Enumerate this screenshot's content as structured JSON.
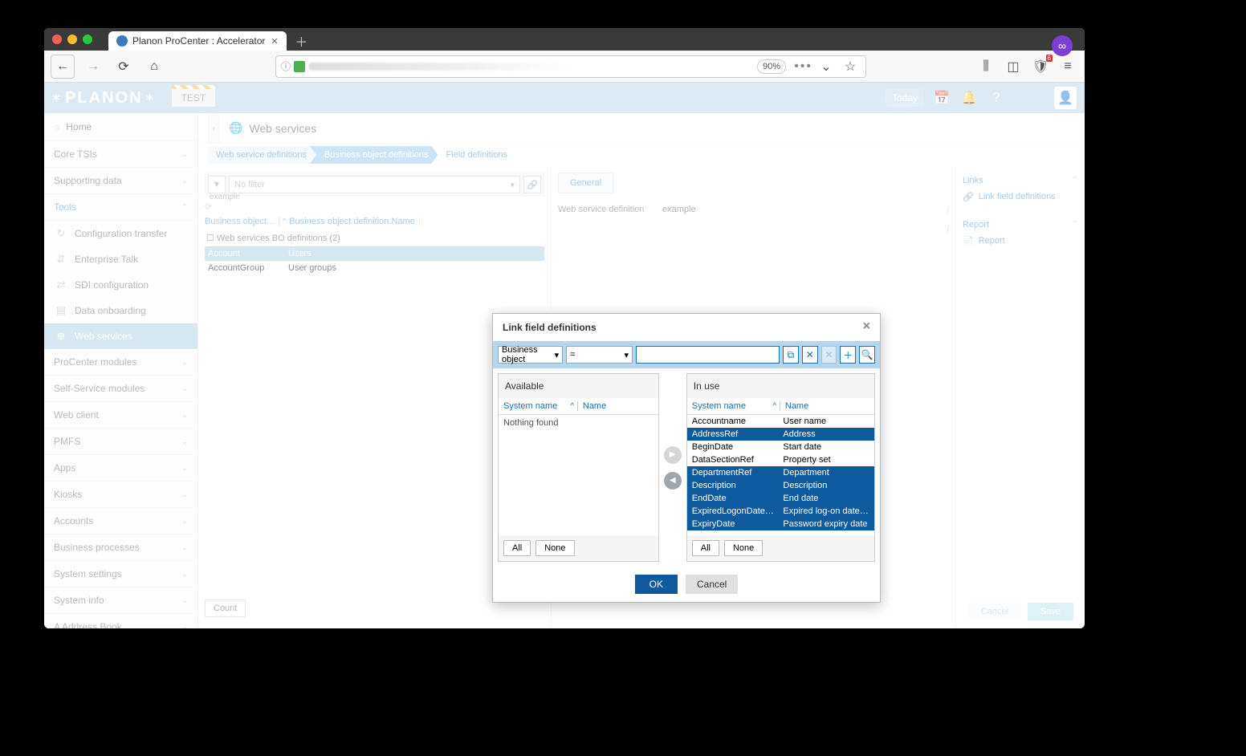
{
  "browser": {
    "tab_title": "Planon ProCenter : Accelerator",
    "zoom": "90%"
  },
  "topbar": {
    "logo": "PLANON",
    "badge": "TEST",
    "today": "Today"
  },
  "sidebar": {
    "home": "Home",
    "sections": [
      {
        "label": "Core TSIs",
        "open": false
      },
      {
        "label": "Supporting data",
        "open": false
      },
      {
        "label": "Tools",
        "open": true,
        "items": [
          {
            "label": "Configuration transfer",
            "icon": "↻"
          },
          {
            "label": "Enterprise Talk",
            "icon": "⇵"
          },
          {
            "label": "SDI configuration",
            "icon": "⇄"
          },
          {
            "label": "Data onboarding",
            "icon": "▤"
          },
          {
            "label": "Web services",
            "icon": "⊕",
            "active": true
          }
        ]
      },
      {
        "label": "ProCenter modules",
        "open": false
      },
      {
        "label": "Self-Service modules",
        "open": false
      },
      {
        "label": "Web client",
        "open": false
      },
      {
        "label": "PMFS",
        "open": false
      },
      {
        "label": "Apps",
        "open": false
      },
      {
        "label": "Kiosks",
        "open": false
      },
      {
        "label": "Accounts",
        "open": false
      },
      {
        "label": "Business processes",
        "open": false
      },
      {
        "label": "System settings",
        "open": false
      },
      {
        "label": "System info",
        "open": false
      },
      {
        "label": "A  Address Book",
        "open": false
      }
    ]
  },
  "main": {
    "title": "Web services",
    "breadcrumb": [
      "Web service definitions",
      "Business object definitions",
      "Field definitions"
    ],
    "bc_note": "example",
    "filter_placeholder": "No filter",
    "colheads": [
      "Business object…",
      "Business object definition.Name"
    ],
    "tree_label": "Web services BO definitions (2)",
    "rows": [
      {
        "c1": "Account",
        "c2": "Users",
        "sel": true
      },
      {
        "c1": "AccountGroup",
        "c2": "User groups",
        "sel": false
      }
    ],
    "count": "Count",
    "general_tab": "General",
    "kv": [
      {
        "k": "Web service definition",
        "v": "example"
      }
    ],
    "cancel": "Cancel",
    "save": "Save"
  },
  "rightpanel": {
    "links": "Links",
    "link_item": "Link field definitions",
    "report": "Report",
    "report_item": "Report"
  },
  "modal": {
    "title": "Link field definitions",
    "filter_field": "Business object",
    "filter_op": "=",
    "available": {
      "title": "Available",
      "col1": "System name",
      "col2": "Name",
      "nothing": "Nothing found",
      "all": "All",
      "none": "None"
    },
    "inuse": {
      "title": "In use",
      "col1": "System name",
      "col2": "Name",
      "rows": [
        {
          "r1": "Accountname",
          "r2": "User name",
          "sel": false
        },
        {
          "r1": "AddressRef",
          "r2": "Address",
          "sel": true
        },
        {
          "r1": "BeginDate",
          "r2": "Start date",
          "sel": false
        },
        {
          "r1": "DataSectionRef",
          "r2": "Property set",
          "sel": false
        },
        {
          "r1": "DepartmentRef",
          "r2": "Department",
          "sel": true
        },
        {
          "r1": "Description",
          "r2": "Description",
          "sel": true
        },
        {
          "r1": "EndDate",
          "r2": "End date",
          "sel": true
        },
        {
          "r1": "ExpiredLogonDate…",
          "r2": "Expired log-on date/tim",
          "sel": true
        },
        {
          "r1": "ExpiryDate",
          "r2": "Password expiry date",
          "sel": true
        }
      ],
      "all": "All",
      "none": "None"
    },
    "ok": "OK",
    "cancel": "Cancel"
  }
}
